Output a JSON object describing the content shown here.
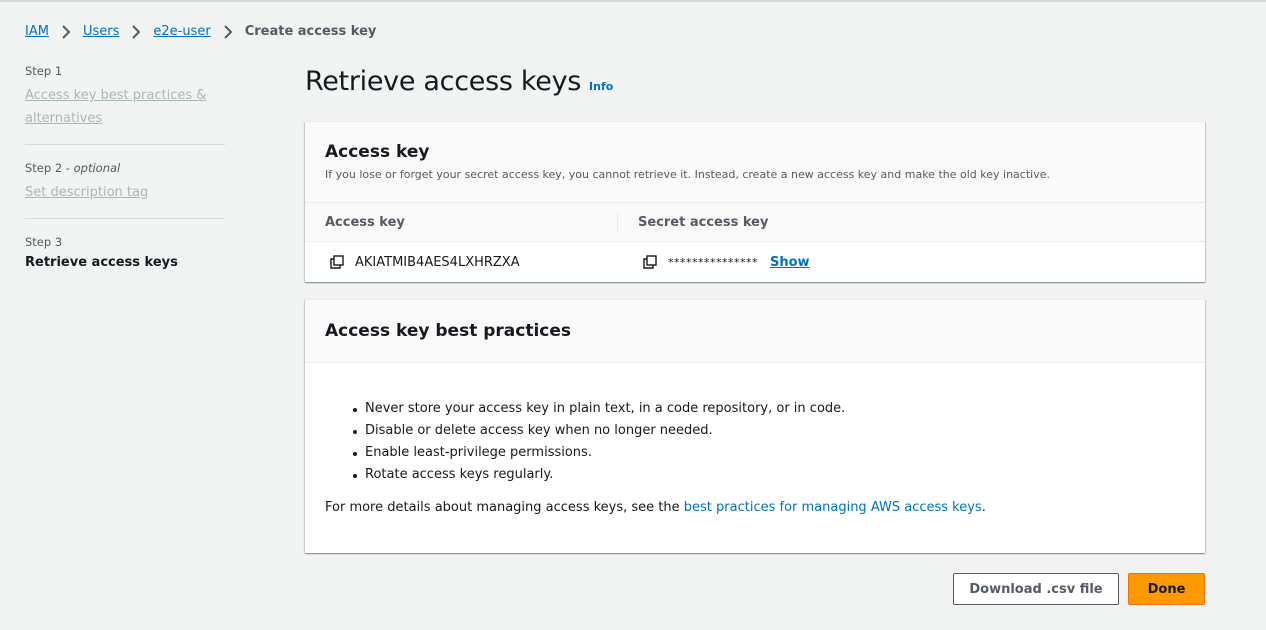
{
  "breadcrumb": {
    "items": [
      "IAM",
      "Users",
      "e2e-user"
    ],
    "current": "Create access key"
  },
  "steps": [
    {
      "label": "Step 1",
      "optional": "",
      "title": "Access key best practices & alternatives"
    },
    {
      "label": "Step 2",
      "optional": "optional",
      "title": "Set description tag"
    },
    {
      "label": "Step 3",
      "optional": "",
      "title": "Retrieve access keys"
    }
  ],
  "page": {
    "title": "Retrieve access keys",
    "info": "Info"
  },
  "access_key_panel": {
    "title": "Access key",
    "description": "If you lose or forget your secret access key, you cannot retrieve it. Instead, create a new access key and make the old key inactive.",
    "col_access_key": "Access key",
    "col_secret_key": "Secret access key",
    "access_key_value": "AKIATMIB4AES4LXHRZXA",
    "secret_masked": "***************",
    "show_label": "Show"
  },
  "best_practices_panel": {
    "title": "Access key best practices",
    "items": [
      "Never store your access key in plain text, in a code repository, or in code.",
      "Disable or delete access key when no longer needed.",
      "Enable least-privilege permissions.",
      "Rotate access keys regularly."
    ],
    "more_prefix": "For more details about managing access keys, see the ",
    "more_link": "best practices for managing AWS access keys",
    "more_suffix": "."
  },
  "buttons": {
    "download": "Download .csv file",
    "done": "Done"
  },
  "colors": {
    "link": "#0073bb",
    "primary_button": "#ff9900",
    "background": "#f2f3f3"
  }
}
